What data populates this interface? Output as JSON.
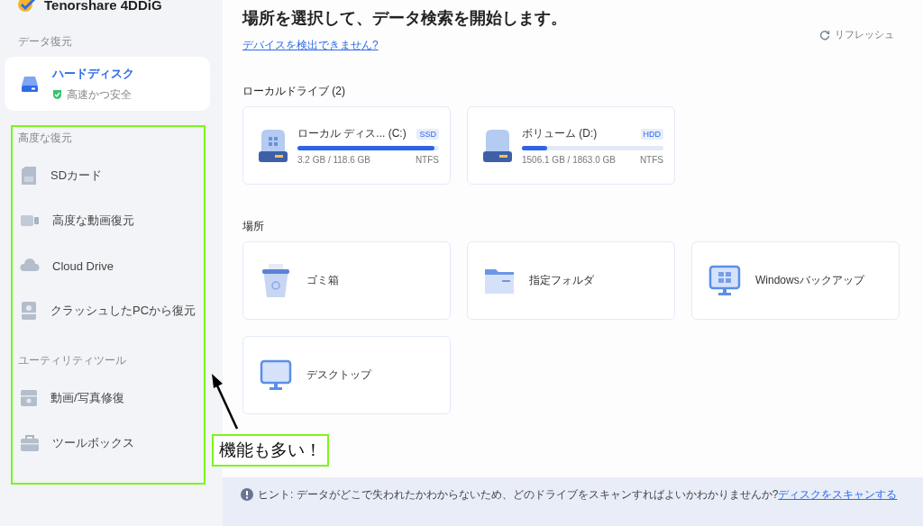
{
  "app": {
    "title": "Tenorshare 4DDiG"
  },
  "sidebar": {
    "sections": [
      {
        "label": "データ復元",
        "items": [
          {
            "label": "ハードディスク",
            "subtitle": "高速かつ安全",
            "selected": true
          }
        ]
      },
      {
        "label": "高度な復元",
        "items": [
          {
            "label": "SDカード",
            "selected": false
          },
          {
            "label": "高度な動画復元",
            "selected": false
          },
          {
            "label": "Cloud Drive",
            "selected": false
          },
          {
            "label": "クラッシュしたPCから復元",
            "selected": false
          }
        ]
      },
      {
        "label": "ユーティリティツール",
        "items": [
          {
            "label": "動画/写真修復",
            "selected": false
          },
          {
            "label": "ツールボックス",
            "selected": false
          }
        ]
      }
    ]
  },
  "main": {
    "title": "場所を選択して、データ検索を開始します。",
    "help_link": "デバイスを検出できません?",
    "refresh": "リフレッシュ",
    "drives_heading": "ローカルドライブ (2)",
    "drives": [
      {
        "name": "ローカル ディス... (C:)",
        "badge": "SSD",
        "level": 0.97,
        "usage": "3.2 GB / 118.6 GB",
        "filesystem": "NTFS"
      },
      {
        "name": "ボリューム (D:)",
        "badge": "HDD",
        "level": 0.18,
        "usage": "1506.1 GB / 1863.0 GB",
        "filesystem": "NTFS"
      }
    ],
    "locations_heading": "場所",
    "locations": [
      {
        "label": "ゴミ箱"
      },
      {
        "label": "指定フォルダ"
      },
      {
        "label": "Windowsバックアップ"
      },
      {
        "label": "デスクトップ"
      }
    ]
  },
  "hint": {
    "text": "ヒント: データがどこで失われたかわからないため、どのドライブをスキャンすればよいかわかりませんか?",
    "link": "ディスクをスキャンする"
  },
  "annotation": {
    "text": "機能も多い！"
  }
}
